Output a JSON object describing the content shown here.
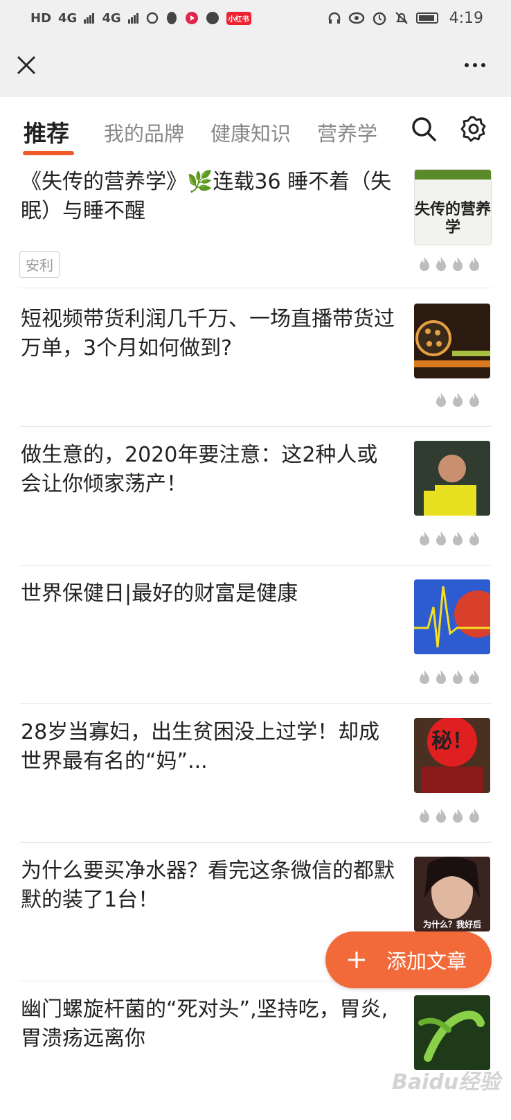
{
  "status_bar": {
    "left_icons": [
      "HD",
      "4G",
      "4G"
    ],
    "app_badge": "小红书",
    "time": "4:19"
  },
  "tabs": [
    {
      "label": "推荐",
      "active": true
    },
    {
      "label": "我的品牌",
      "active": false
    },
    {
      "label": "健康知识",
      "active": false
    },
    {
      "label": "营养学",
      "active": false
    }
  ],
  "articles": [
    {
      "title": "《失传的营养学》🌿连载36 睡不着（失眠）与睡不醒",
      "tag": "安利",
      "heat": 4,
      "thumb_text": "失传的营养学"
    },
    {
      "title": "短视频带货利润几千万、一场直播带货过万单，3个月如何做到?",
      "heat": 3
    },
    {
      "title": "做生意的，2020年要注意：这2种人或会让你倾家荡产！",
      "heat": 4
    },
    {
      "title": "世界保健日|最好的财富是健康",
      "heat": 4
    },
    {
      "title": "28岁当寡妇，出生贫困没上过学！却成世界最有名的“妈”...",
      "heat": 4,
      "thumb_text": "秘！"
    },
    {
      "title": "为什么要买净水器？看完这条微信的都默默的装了1台！",
      "thumb_text": "为什么？我好后"
    },
    {
      "title": "幽门螺旋杆菌的“死对头”,坚持吃，胃炎,胃溃疡远离你"
    }
  ],
  "fab": {
    "label": "添加文章"
  },
  "watermark": "Baidu经验",
  "colors": {
    "accent": "#f05a28",
    "fab": "#f26a3a",
    "bar": "#f0f0f0"
  }
}
